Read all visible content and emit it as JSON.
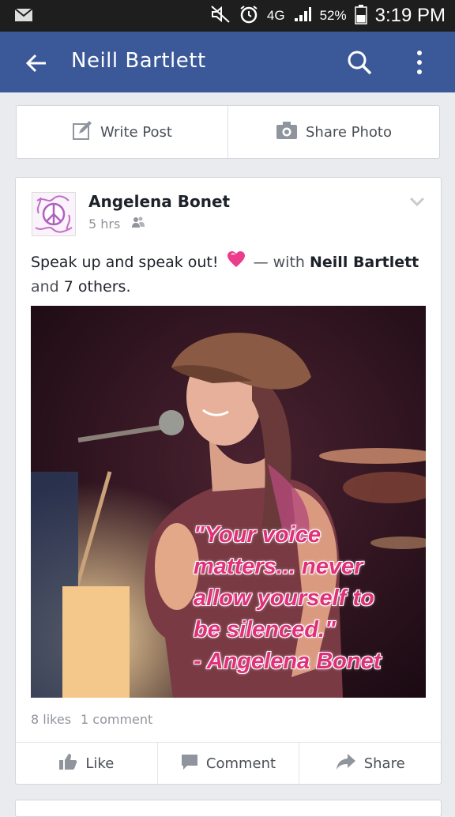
{
  "status_bar": {
    "battery": "52%",
    "time": "3:19 PM",
    "network": "4G"
  },
  "app_bar": {
    "title": "Neill Bartlett"
  },
  "composer": {
    "write_post": "Write Post",
    "share_photo": "Share Photo"
  },
  "post": {
    "author": "Angelena Bonet",
    "time": "5 hrs",
    "text_start": "Speak up and speak out!",
    "with": "— with",
    "tagged": "Neill Bartlett",
    "and": "and",
    "others": "7 others.",
    "quote": "\"Your voice\nmatters... never\nallow yourself to\nbe silenced.\"\n- Angelena Bonet",
    "likes": "8 likes",
    "comments": "1 comment"
  },
  "actions": {
    "like": "Like",
    "comment": "Comment",
    "share": "Share"
  },
  "colors": {
    "brand": "#3b5998",
    "quote_pink": "#e0307a"
  }
}
